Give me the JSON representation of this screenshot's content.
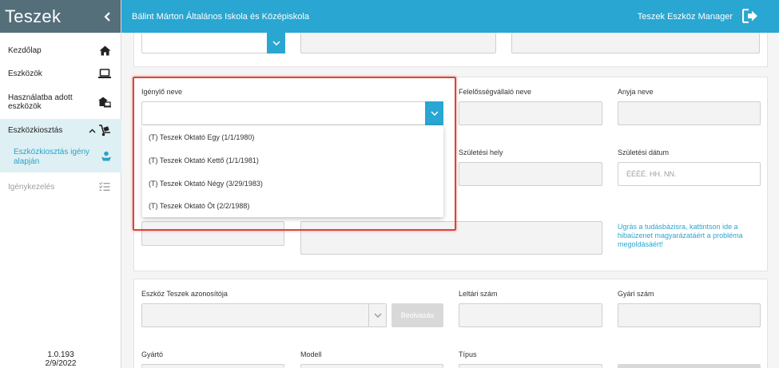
{
  "sidebar": {
    "title": "Teszek",
    "collapse_glyph": "‹",
    "items": [
      {
        "label": "Kezdőlap"
      },
      {
        "label": "Eszközök"
      },
      {
        "label_line1": "Használatba adott",
        "label_line2": "eszközök"
      },
      {
        "label": "Eszközkiosztás"
      },
      {
        "label": "Igénykezelés"
      }
    ],
    "subitem": {
      "label_line1": "Eszközkiosztás igény",
      "label_line2": "alapján"
    },
    "version": "1.0.193",
    "date": "2/9/2022"
  },
  "topbar": {
    "school": "Bálint Márton Általános Iskola és Középiskola",
    "app_name": "Teszek Eszköz Manager"
  },
  "form": {
    "igenylo_label": "Igénylő neve",
    "felelos_label": "Felelősségvállaló neve",
    "anyja_label": "Anyja neve",
    "szuletesi_hely_label": "Születési hely",
    "szuletesi_datum_label": "Születési dátum",
    "szuletesi_datum_placeholder": "ÉÉÉÉ. HH. NN.",
    "help_line1": "Ugrás a tudásbázisra, kattintson ide a",
    "help_line2": "hibaüzenet magyarázatáért a probléma",
    "help_line3": "megoldásáért!",
    "eszkoz_azonosito_label": "Eszköz Teszek azonosítója",
    "beolvasas_label": "Beolvasás",
    "leltari_label": "Leltári szám",
    "gyari_label": "Gyári szám",
    "gyarto_label": "Gyártó",
    "modell_label": "Modell",
    "tipus_label": "Típus"
  },
  "dropdown_options": [
    "(T) Teszek Oktató Egy (1/1/1980)",
    "(T) Teszek Oktató Kettő (1/1/1981)",
    "(T) Teszek Oktató Négy (3/29/1983)",
    "(T) Teszek Oktató Öt (2/2/1988)"
  ],
  "colors": {
    "sidebar_header": "#546e7a",
    "topbar": "#29a6d1",
    "accent": "#29a6d1",
    "highlight": "#d9463a",
    "active_bg": "#dff0f5"
  }
}
